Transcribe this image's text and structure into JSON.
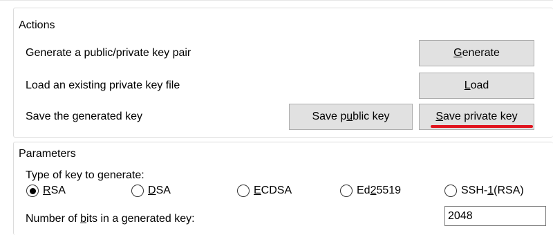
{
  "actions": {
    "title": "Actions",
    "rows": [
      {
        "label": "Generate a public/private key pair"
      },
      {
        "label": "Load an existing private key file"
      },
      {
        "label": "Save the generated key"
      }
    ],
    "buttons": {
      "generate": {
        "pre": "",
        "mn": "G",
        "post": "enerate"
      },
      "load": {
        "pre": "",
        "mn": "L",
        "post": "oad"
      },
      "save_public": {
        "pre": "Save p",
        "mn": "u",
        "post": "blic key"
      },
      "save_private": {
        "pre": "",
        "mn": "S",
        "post": "ave private key"
      }
    },
    "highlight_color": "#e0141e"
  },
  "parameters": {
    "title": "Parameters",
    "type_label": "Type of key to generate:",
    "radios": [
      {
        "pre": "",
        "mn": "R",
        "post": "SA",
        "selected": true
      },
      {
        "pre": "",
        "mn": "D",
        "post": "SA",
        "selected": false
      },
      {
        "pre": "",
        "mn": "E",
        "post": "CDSA",
        "selected": false
      },
      {
        "pre": "Ed",
        "mn": "2",
        "post": "5519",
        "selected": false
      },
      {
        "pre": "SSH-",
        "mn": "1",
        "post": " (RSA)",
        "selected": false
      }
    ],
    "bits_label": {
      "pre": "Number of ",
      "mn": "b",
      "post": "its in a generated key:"
    },
    "bits_value": "2048"
  }
}
